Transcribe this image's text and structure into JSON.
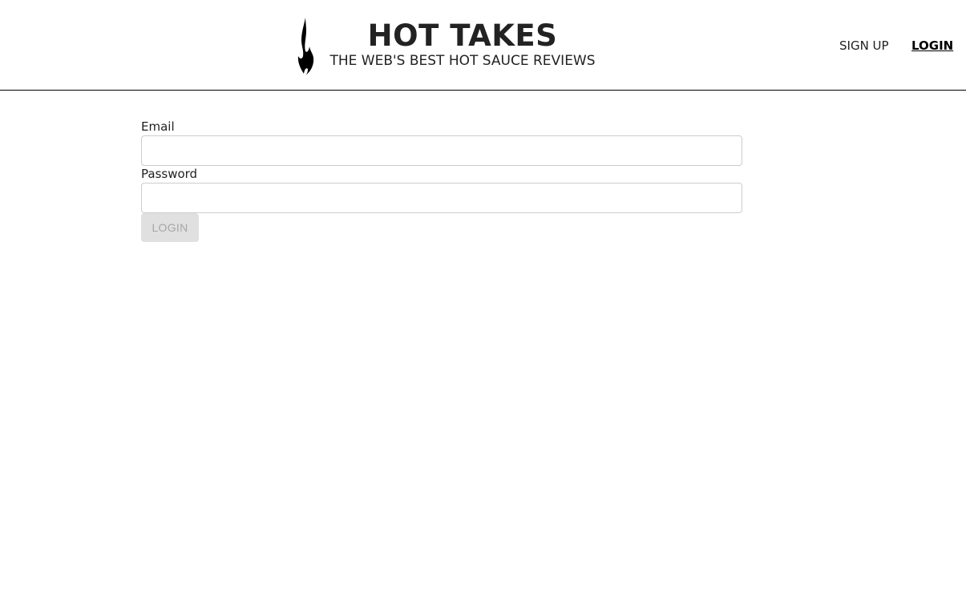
{
  "header": {
    "title": "HOT TAKES",
    "subtitle": "THE WEB'S BEST HOT SAUCE REVIEWS",
    "logo_icon": "flame-icon"
  },
  "nav": {
    "signup_label": "SIGN UP",
    "login_label": "LOGIN",
    "active": "login"
  },
  "form": {
    "email_label": "Email",
    "email_value": "",
    "password_label": "Password",
    "password_value": "",
    "submit_label": "LOGIN",
    "submit_disabled": true
  },
  "colors": {
    "text": "#212121",
    "border": "#cccccc",
    "disabled_button_bg": "#e0e0e0",
    "disabled_button_text": "#a6a6a6"
  }
}
